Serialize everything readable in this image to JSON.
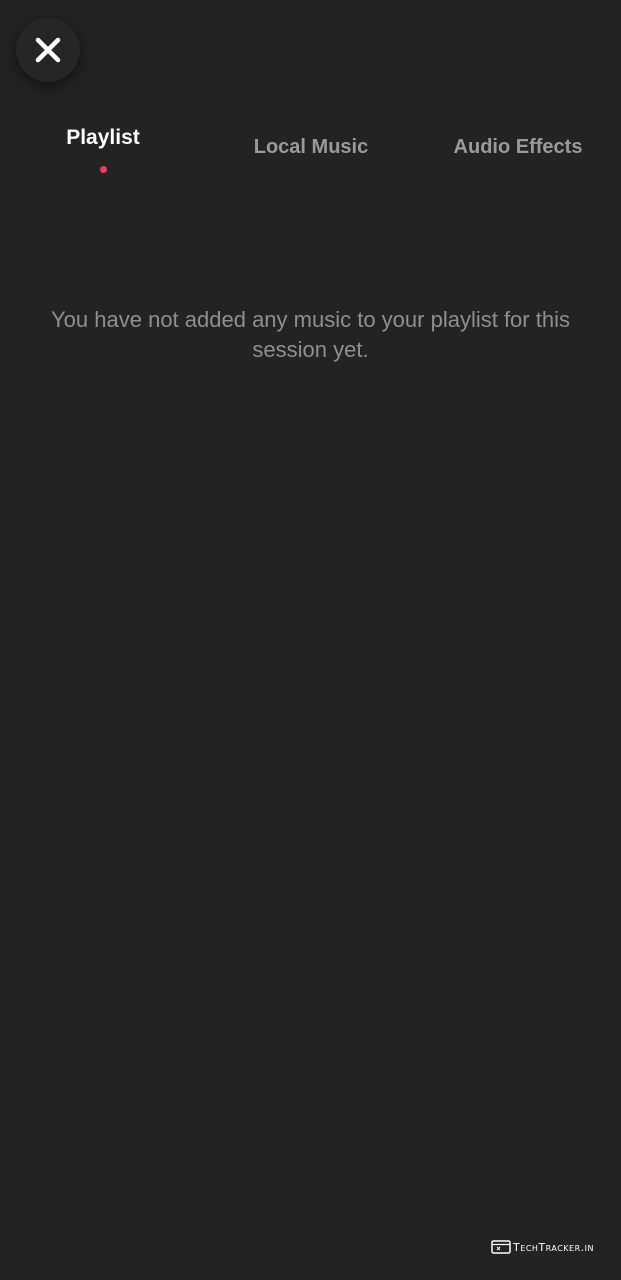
{
  "header": {
    "close_icon": "close-icon"
  },
  "tabs": [
    {
      "label": "Playlist",
      "active": true
    },
    {
      "label": "Local Music",
      "active": false
    },
    {
      "label": "Audio Effects",
      "active": false
    }
  ],
  "playlist": {
    "empty_message": "You have not added any music to your playlist for this session yet."
  },
  "watermark": {
    "text": "TechTracker.in",
    "icon": "browser-window-icon"
  },
  "colors": {
    "background": "#232323",
    "active_tab_text": "#ffffff",
    "inactive_tab_text": "#9a9a9a",
    "active_indicator": "#ec3e63",
    "message_text": "#8f8f8f"
  }
}
